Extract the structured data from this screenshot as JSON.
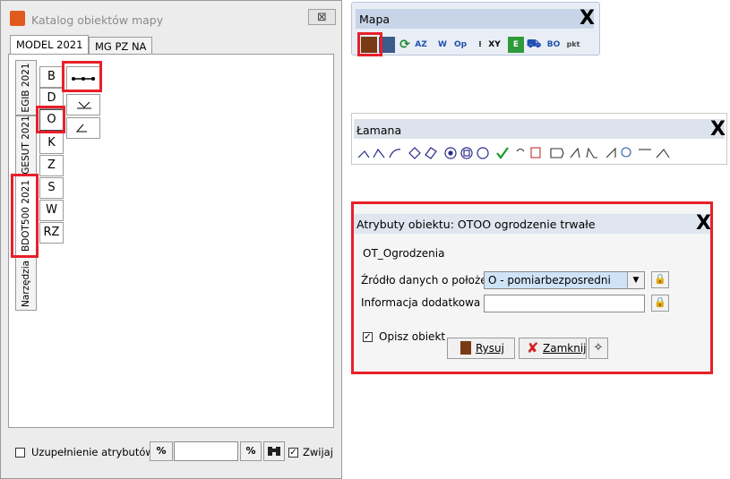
{
  "katalog": {
    "title": "Katalog obiektów mapy",
    "close_label": "⊠",
    "tabs": [
      "MODEL 2021",
      "MG PZ NA"
    ],
    "vtabs": [
      "EGIB 2021",
      "GESUT 2021",
      "BDOT500 2021",
      "Narzędzia"
    ],
    "letters": [
      "B",
      "D",
      "O",
      "K",
      "Z",
      "S",
      "W",
      "RZ"
    ],
    "footer": {
      "uzupelnienie_label": "Uzupełnienie atrybutów",
      "percent_left": "%",
      "percent_right": "%",
      "search_value": "",
      "zwijaj_label": "Zwijaj"
    }
  },
  "mapa": {
    "title": "Mapa",
    "close": "X",
    "tools": [
      "Op",
      "XY",
      "BO"
    ]
  },
  "lamana": {
    "title": "Łamana",
    "close": "X"
  },
  "atrybuty": {
    "title": "Atrybuty obiektu: OTOO ogrodzenie trwałe",
    "close": "X",
    "class_name": "OT_Ogrodzenia",
    "zrodlo_label": "Źródło danych o położen",
    "zrodlo_value": "O - pomiarbezposredni",
    "info_label": "Informacja dodatkowa :",
    "info_value": "",
    "opisz_label": "Opisz obiekt",
    "rysuj_label": "Rysuj",
    "zamknij_label": "Zamknij"
  },
  "colors": {
    "highlight": "#e8202a",
    "toolbar_title": "#c8d5e8",
    "dropdown_bg": "#cfe3f7"
  }
}
